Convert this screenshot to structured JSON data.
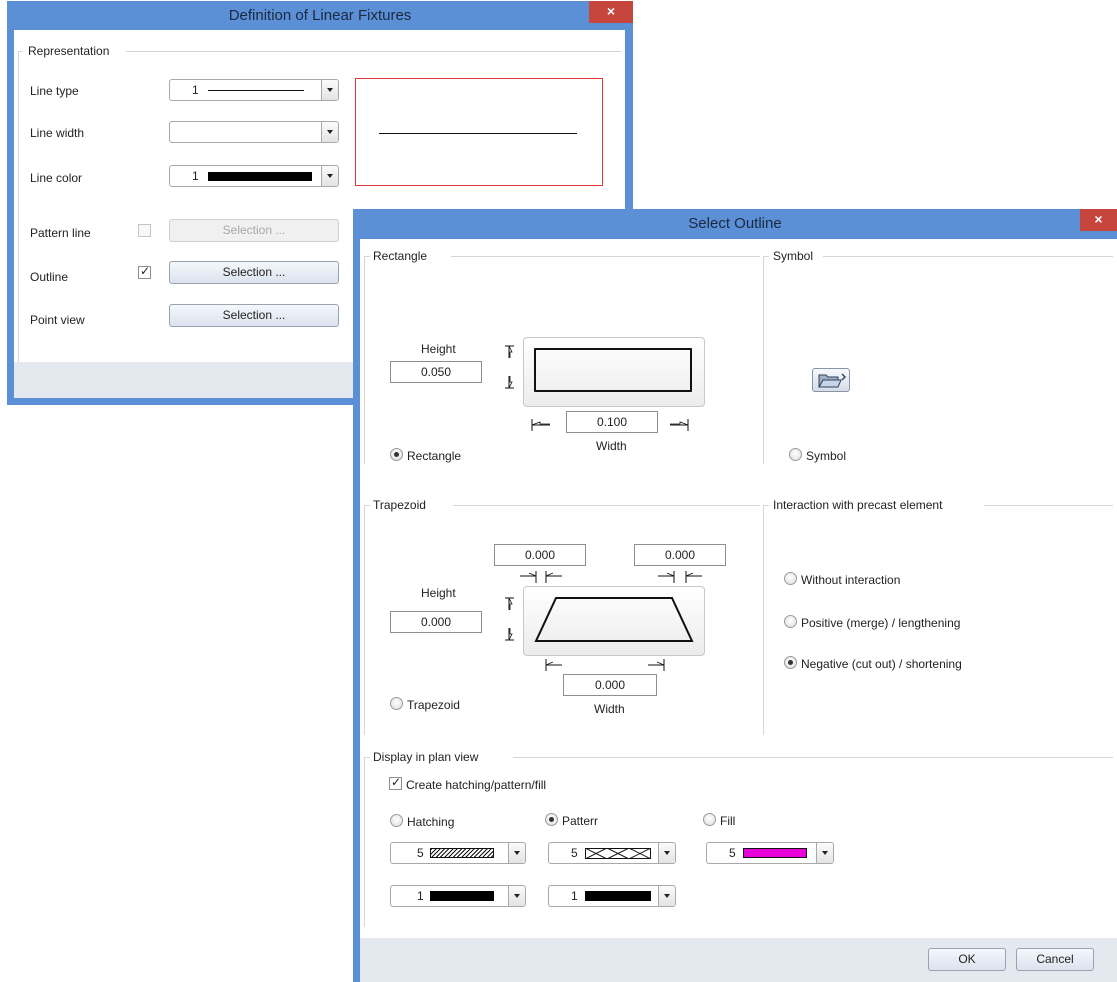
{
  "dialog1": {
    "title": "Definition of Linear Fixtures",
    "close_glyph": "×",
    "group_representation": "Representation",
    "line_type_label": "Line type",
    "line_type_value": "1",
    "line_width_label": "Line width",
    "line_color_label": "Line color",
    "line_color_value": "1",
    "pattern_line_label": "Pattern line",
    "outline_label": "Outline",
    "point_view_label": "Point view",
    "selection_label": "Selection ...",
    "pattern_line_checked": false,
    "outline_checked": true
  },
  "dialog2": {
    "title": "Select Outline",
    "close_glyph": "×",
    "rectangle": {
      "group": "Rectangle",
      "height_label": "Height",
      "height_value": "0.050",
      "width_value": "0.100",
      "width_label": "Width",
      "radio_label": "Rectangle",
      "selected": true
    },
    "symbol": {
      "group": "Symbol",
      "radio_label": "Symbol",
      "icon": "folder-open-icon"
    },
    "trapezoid": {
      "group": "Trapezoid",
      "top_left_value": "0.000",
      "top_right_value": "0.000",
      "height_label": "Height",
      "height_value": "0.000",
      "width_value": "0.000",
      "width_label": "Width",
      "radio_label": "Trapezoid"
    },
    "interaction": {
      "group": "Interaction with precast element",
      "options": [
        "Without interaction",
        "Positive (merge) / lengthening",
        "Negative (cut out) / shortening"
      ],
      "selected_index": 2
    },
    "display": {
      "group": "Display in plan view",
      "create_label": "Create hatching/pattern/fill",
      "hatching_label": "Hatching",
      "pattern_label": "Patterr",
      "fill_label": "Fill",
      "hatching_value": "5",
      "pattern_value": "5",
      "fill_value": "5",
      "hatching_color_value": "1",
      "pattern_color_value": "1",
      "fill_color": "#e800d8"
    },
    "ok_label": "OK",
    "cancel_label": "Cancel"
  }
}
